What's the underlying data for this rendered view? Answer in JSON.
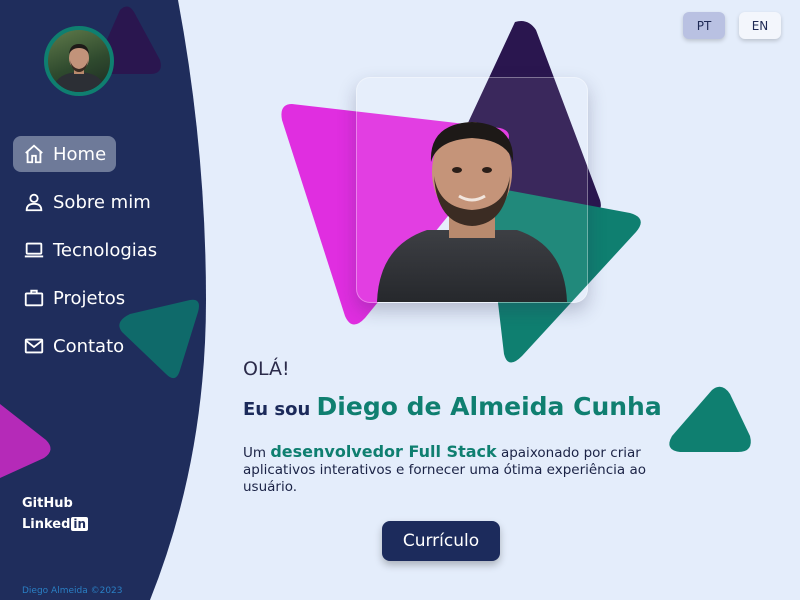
{
  "sidebar": {
    "avatar_alt": "Diego de Almeida Cunha",
    "nav": [
      {
        "label": "Home",
        "icon": "home-icon"
      },
      {
        "label": "Sobre mim",
        "icon": "user-icon"
      },
      {
        "label": "Tecnologias",
        "icon": "laptop-icon"
      },
      {
        "label": "Projetos",
        "icon": "briefcase-icon"
      },
      {
        "label": "Contato",
        "icon": "mail-icon"
      }
    ],
    "social": {
      "github": "GitHub",
      "linkedin_text": "Linked",
      "linkedin_box": "in"
    },
    "credit": "Diego Almeida ©2023"
  },
  "language": {
    "pt": "PT",
    "en": "EN",
    "active": "PT"
  },
  "hero": {
    "greeting": "OLÁ!",
    "intro_prefix": "Eu sou ",
    "name": "Diego de Almeida Cunha",
    "desc_prefix": "Um ",
    "desc_highlight": "desenvolvedor Full Stack",
    "desc_rest": " apaixonado por criar aplicativos interativos e fornecer uma ótima experiência ao usuário.",
    "button": "Currículo"
  },
  "colors": {
    "sidebar": "#1f2d5c",
    "accent_teal": "#0f7f70",
    "magenta": "#e02ee0",
    "purple": "#2a164f",
    "background": "#e4edfb"
  }
}
